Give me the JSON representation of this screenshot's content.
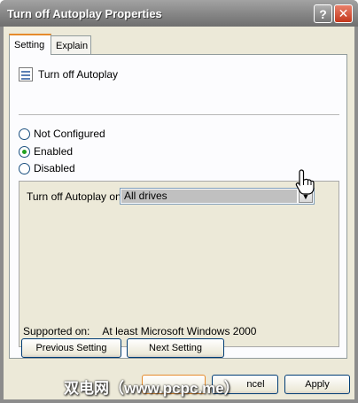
{
  "window": {
    "title": "Turn off Autoplay Properties",
    "help_glyph": "?",
    "close_glyph": "✕"
  },
  "tabs": [
    "Setting",
    "Explain"
  ],
  "policy": {
    "name": "Turn off Autoplay",
    "icon": "policy-icon"
  },
  "radios": [
    {
      "label": "Not Configured",
      "checked": false
    },
    {
      "label": "Enabled",
      "checked": true
    },
    {
      "label": "Disabled",
      "checked": false
    }
  ],
  "options": {
    "label": "Turn off Autoplay on:",
    "selected_value": "All drives"
  },
  "supported": {
    "label": "Supported on:",
    "value": "At least Microsoft Windows 2000"
  },
  "buttons": {
    "previous": "Previous Setting",
    "next": "Next Setting",
    "cancel": "ncel",
    "apply": "Apply"
  },
  "watermark": "双电网（www.pcpc.me）"
}
